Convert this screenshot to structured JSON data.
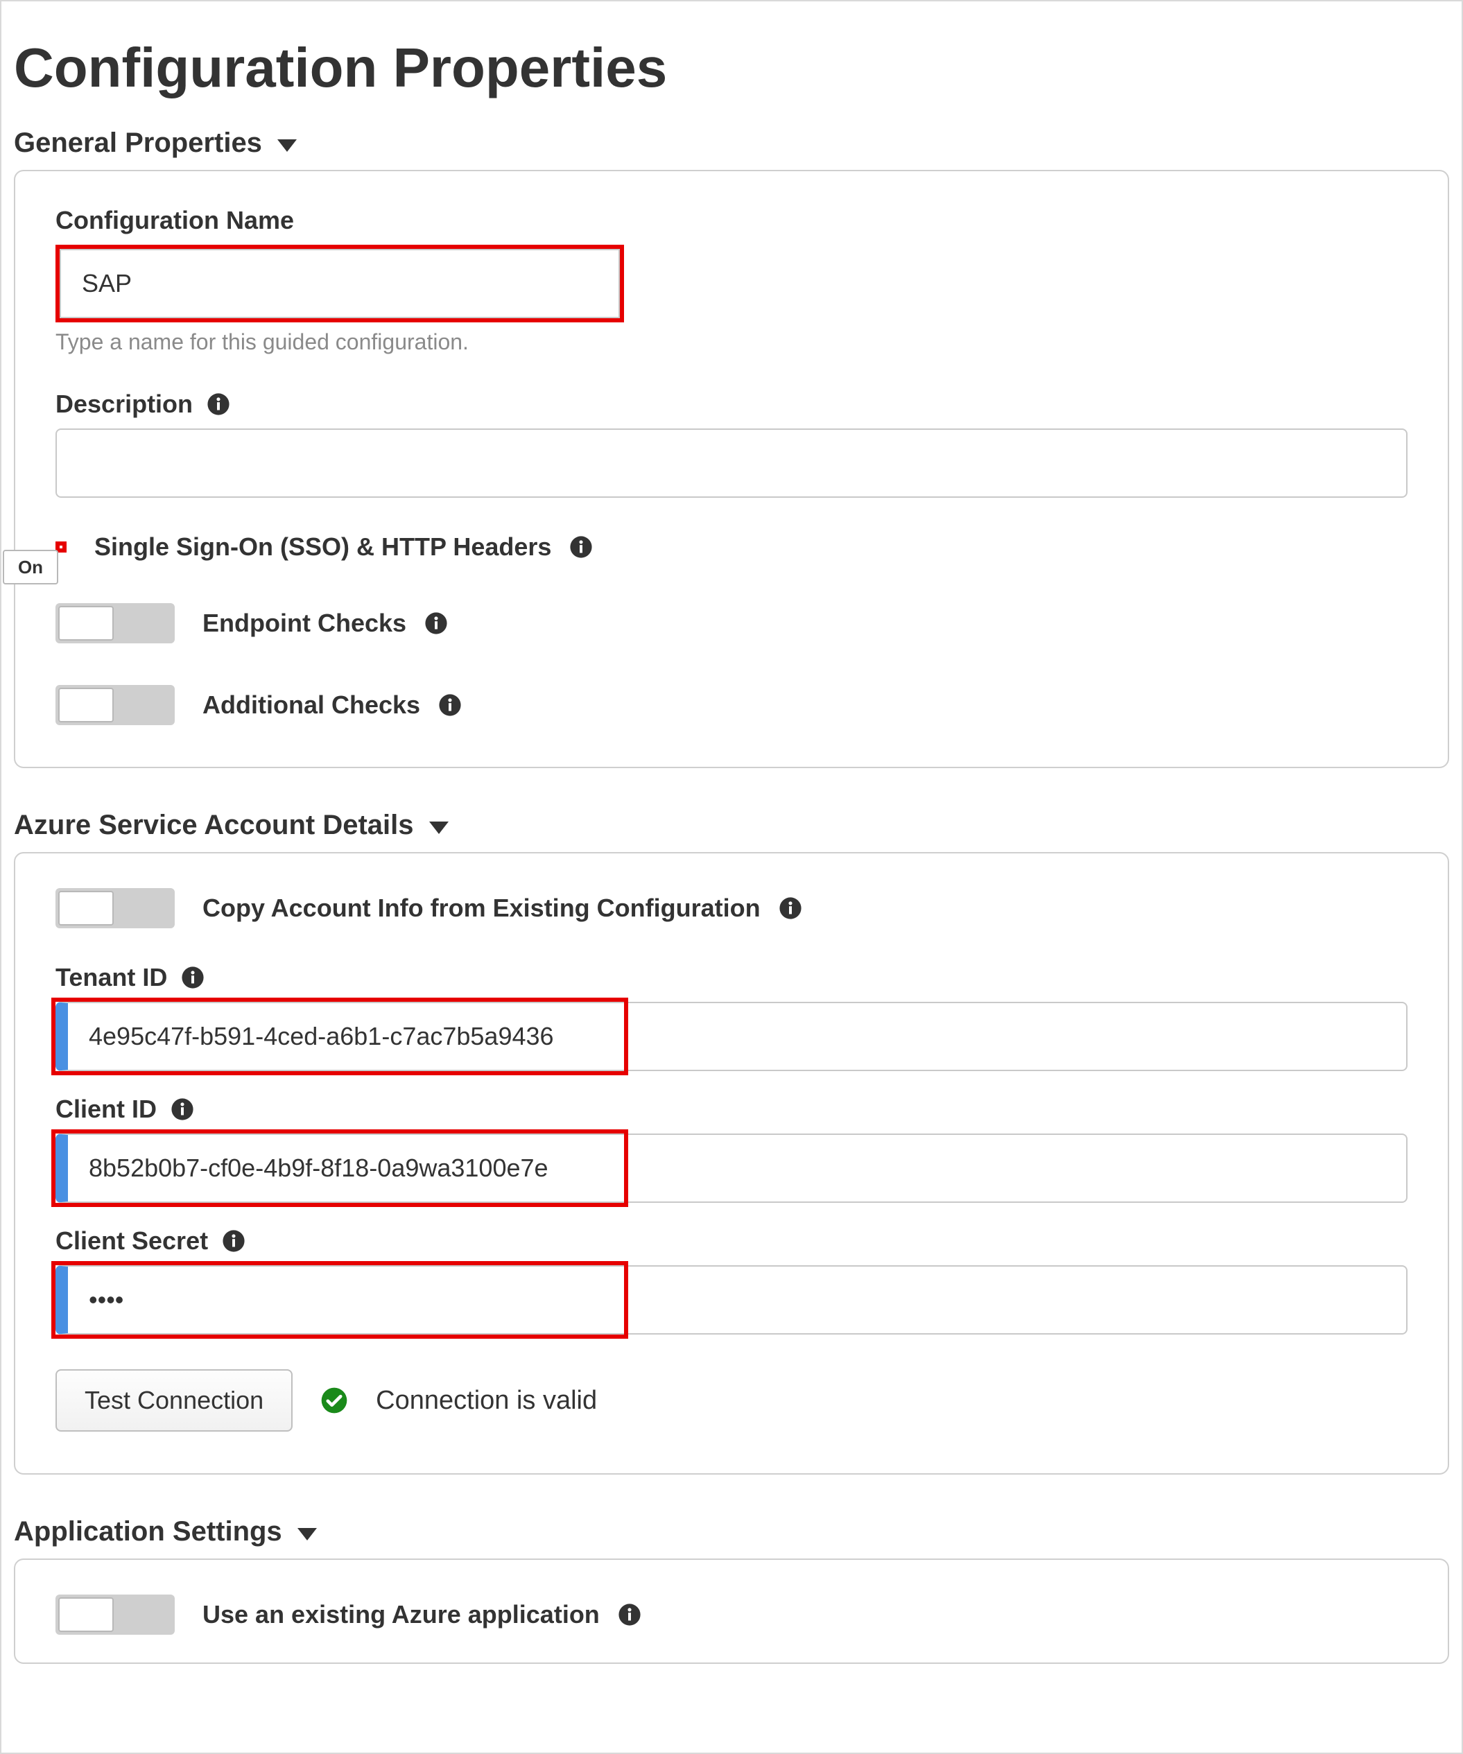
{
  "page": {
    "title": "Configuration Properties"
  },
  "sections": {
    "general": {
      "title": "General Properties"
    },
    "azure": {
      "title": "Azure Service Account Details"
    },
    "app": {
      "title": "Application Settings"
    }
  },
  "general": {
    "config_name": {
      "label": "Configuration Name",
      "value": "SAP",
      "help": "Type a name for this guided configuration."
    },
    "description": {
      "label": "Description",
      "value": ""
    },
    "toggles": {
      "sso": {
        "label": "Single Sign-On (SSO) & HTTP Headers",
        "state_text": "On",
        "on": true
      },
      "endpoint": {
        "label": "Endpoint Checks",
        "on": false
      },
      "additional": {
        "label": "Additional Checks",
        "on": false
      }
    }
  },
  "azure": {
    "copy_existing": {
      "label": "Copy Account Info from Existing Configuration",
      "on": false
    },
    "tenant_id": {
      "label": "Tenant ID",
      "value": "4e95c47f-b591-4ced-a6b1-c7ac7b5a9436"
    },
    "client_id": {
      "label": "Client ID",
      "value": "8b52b0b7-cf0e-4b9f-8f18-0a9wa3100e7e"
    },
    "client_secret": {
      "label": "Client Secret",
      "value": "••••"
    },
    "test_btn": "Test Connection",
    "conn_status": "Connection is valid"
  },
  "app": {
    "use_existing": {
      "label": "Use an existing Azure application",
      "on": false
    }
  }
}
